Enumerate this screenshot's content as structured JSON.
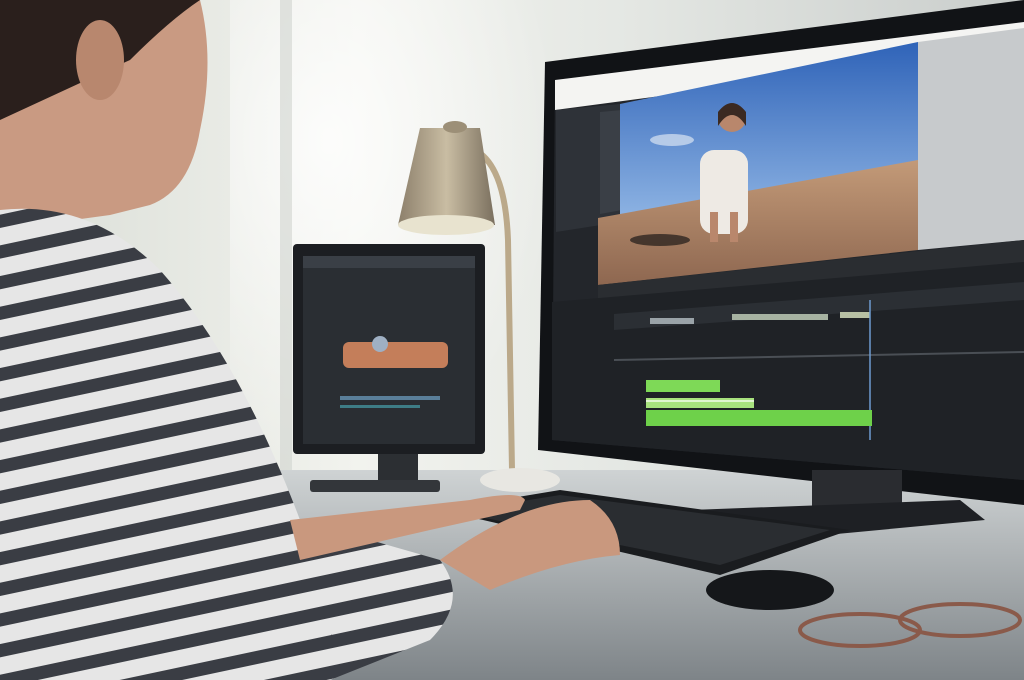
{
  "scene": {
    "description_elements": [
      "person",
      "main-monitor",
      "secondary-monitor",
      "desk-lamp",
      "keyboard",
      "mouse",
      "desk"
    ]
  },
  "editor": {
    "timeline_tracks": 3
  },
  "colors": {
    "accent_green": "#7ed957",
    "sky_blue": "#3f79c8",
    "desert_sand": "#b88a6a",
    "ui_dark": "#1f2226",
    "wall_light": "#e9ece7"
  }
}
